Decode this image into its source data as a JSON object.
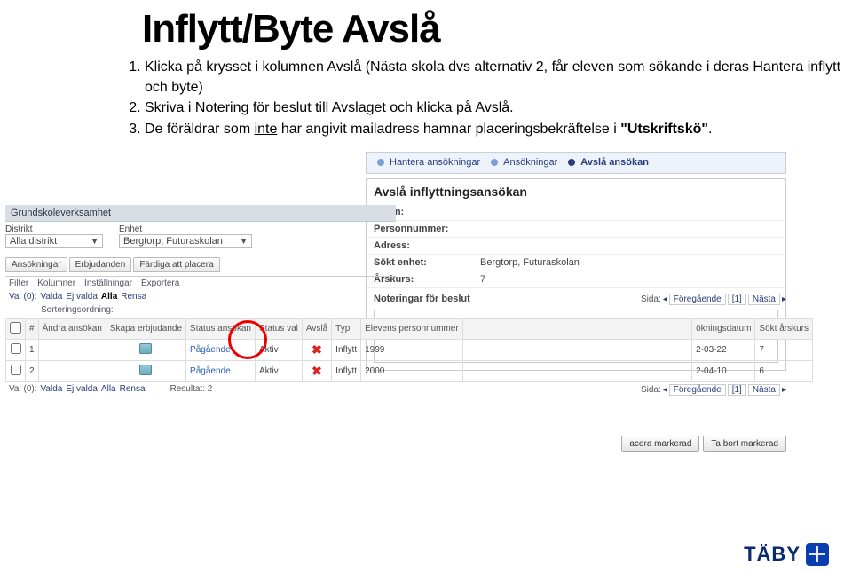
{
  "page": {
    "title": "Inflytt/Byte Avslå"
  },
  "instructions": [
    {
      "n": "1.",
      "text": "Klicka på krysset i kolumnen Avslå (Nästa skola dvs alternativ 2, får eleven som sökande i deras Hantera inflytt och byte)"
    },
    {
      "n": "2.",
      "text": "Skriva i Notering för beslut till Avslaget och klicka på Avslå."
    },
    {
      "n": "3.",
      "pre": "De föräldrar som ",
      "underline": "inte",
      "post": " har angivit mailadress hamnar placeringsbekräftelse i ",
      "bold": "\"Utskriftskö\"",
      "tail": "."
    }
  ],
  "breadcrumb": [
    {
      "label": "Hantera ansökningar",
      "active": false
    },
    {
      "label": "Ansökningar",
      "active": false
    },
    {
      "label": "Avslå ansökan",
      "active": true
    }
  ],
  "right_panel": {
    "title": "Avslå inflyttningsansökan",
    "rows": [
      {
        "label": "Namn:",
        "value": ""
      },
      {
        "label": "Personnummer:",
        "value": ""
      },
      {
        "label": "Adress:",
        "value": ""
      },
      {
        "label": "Sökt enhet:",
        "value": "Bergtorp, Futuraskolan"
      },
      {
        "label": "Årskurs:",
        "value": "7"
      }
    ],
    "notes_label": "Noteringar för beslut"
  },
  "left": {
    "section_label": "Grundskoleverksamhet",
    "district_label": "Distrikt",
    "district_value": "Alla distrikt",
    "unit_label": "Enhet",
    "unit_value": "Bergtorp, Futuraskolan",
    "tabs": [
      "Ansökningar",
      "Erbjudanden",
      "Färdiga att placera"
    ],
    "subtabs": [
      "Filter",
      "Kolumner",
      "Inställningar",
      "Exportera"
    ],
    "val_prefix": "Val (0):",
    "val_links": [
      "Valda",
      "Ej valda",
      "Alla",
      "Rensa"
    ],
    "sort_label": "Sorteringsordning:",
    "result_label": "Resultat: 2"
  },
  "table": {
    "headers": [
      "",
      "#",
      "Ändra ansökan",
      "Skapa erbjudande",
      "Status ansökan",
      "Status val",
      "Avslå",
      "Typ",
      "Elevens personnummer",
      "",
      "ökningsdatum",
      "Sökt årskurs"
    ],
    "rows": [
      {
        "num": "1",
        "status_ansokan": "Pågående",
        "status_val": "Aktiv",
        "typ": "Inflytt",
        "pnr": "1999",
        "datum": "2-03-22",
        "arskurs": "7"
      },
      {
        "num": "2",
        "status_ansokan": "Pågående",
        "status_val": "Aktiv",
        "typ": "Inflytt",
        "pnr": "2000",
        "datum": "2-04-10",
        "arskurs": "6"
      }
    ]
  },
  "pager": {
    "sida": "Sida:",
    "prev": "Föregående",
    "page": "[1]",
    "next": "Nästa"
  },
  "bottom_buttons": [
    "acera markerad",
    "Ta bort markerad"
  ],
  "logo": {
    "text": "TÄBY"
  }
}
